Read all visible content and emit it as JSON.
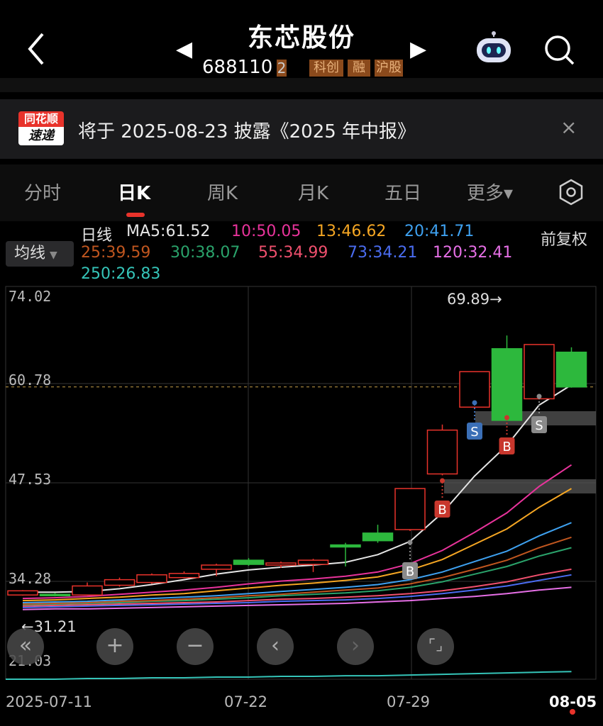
{
  "header": {
    "title": "东芯股份",
    "code": "688110",
    "code_suffix": "2",
    "badges": [
      "科创",
      "融",
      "沪股"
    ]
  },
  "notice": {
    "brand_top": "同花顺",
    "brand_bottom": "速递",
    "text": "将于 2025-08-23 披露《2025 年中报》",
    "close": "×"
  },
  "tabs": [
    "分时",
    "日K",
    "周K",
    "月K",
    "五日",
    "更多▾"
  ],
  "indicator": {
    "label": "日线",
    "ma": [
      {
        "text": "MA5:61.52",
        "color": "#e6e6e6"
      },
      {
        "text": "10:50.05",
        "color": "#e8339b"
      },
      {
        "text": "13:46.62",
        "color": "#f5a623"
      },
      {
        "text": "20:41.71",
        "color": "#3ea1f0"
      },
      {
        "text": "25:39.59",
        "color": "#c0561f"
      },
      {
        "text": "30:38.07",
        "color": "#2aa36b"
      },
      {
        "text": "55:34.99",
        "color": "#f0506e"
      },
      {
        "text": "73:34.21",
        "color": "#4a6cf0"
      },
      {
        "text": "120:32.41",
        "color": "#e66fe6"
      },
      {
        "text": "250:26.83",
        "color": "#35c4b8"
      }
    ],
    "ma_button": "均线",
    "adjust": "前复权"
  },
  "chart_data": {
    "type": "candlestick",
    "y_ticks": [
      "74.02",
      "60.78",
      "47.53",
      "34.28",
      "21.03"
    ],
    "ylim": [
      21.03,
      74.02
    ],
    "x_labels": [
      "2025-07-11",
      "07-22",
      "07-29",
      "08-05"
    ],
    "high_label": "69.89→",
    "low_label": "←31.21",
    "candles": [
      {
        "o": 31.3,
        "c": 31.9,
        "h": 32.0,
        "l": 31.2
      },
      {
        "o": 31.4,
        "c": 31.2,
        "h": 31.6,
        "l": 31.1
      },
      {
        "o": 31.3,
        "c": 32.6,
        "h": 33.1,
        "l": 31.2
      },
      {
        "o": 32.7,
        "c": 33.5,
        "h": 33.8,
        "l": 32.5
      },
      {
        "o": 33.1,
        "c": 34.2,
        "h": 34.4,
        "l": 32.9
      },
      {
        "o": 33.8,
        "c": 34.4,
        "h": 34.7,
        "l": 33.7
      },
      {
        "o": 35.0,
        "c": 35.6,
        "h": 35.8,
        "l": 34.0
      },
      {
        "o": 36.3,
        "c": 35.7,
        "h": 36.6,
        "l": 35.5
      },
      {
        "o": 35.6,
        "c": 35.9,
        "h": 36.1,
        "l": 35.2
      },
      {
        "o": 35.7,
        "c": 36.3,
        "h": 36.5,
        "l": 34.6
      },
      {
        "o": 38.5,
        "c": 38.2,
        "h": 38.8,
        "l": 35.4
      },
      {
        "o": 40.2,
        "c": 39.1,
        "h": 41.4,
        "l": 38.8
      },
      {
        "o": 40.7,
        "c": 46.6,
        "h": 46.6,
        "l": 40.5
      },
      {
        "o": 48.7,
        "c": 55.0,
        "h": 55.8,
        "l": 48.5
      },
      {
        "o": 58.3,
        "c": 63.4,
        "h": 63.4,
        "l": 58.0
      },
      {
        "o": 66.7,
        "c": 56.4,
        "h": 68.6,
        "l": 56.4
      },
      {
        "o": 59.5,
        "c": 67.3,
        "h": 67.3,
        "l": 59.4
      },
      {
        "o": 66.2,
        "c": 61.2,
        "h": 66.9,
        "l": 61.1
      }
    ],
    "signals": [
      {
        "i": 12,
        "label": "B",
        "type": "buy"
      },
      {
        "i": 13,
        "label": "B",
        "type": "buy"
      },
      {
        "i": 14,
        "label": "S",
        "type": "sell"
      },
      {
        "i": 15,
        "label": "B",
        "type": "buy"
      },
      {
        "i": 16,
        "label": "S",
        "type": "grey"
      },
      {
        "i": 12,
        "label": "B",
        "type": "grey"
      }
    ],
    "ma5": [
      31.7,
      31.7,
      31.8,
      32.2,
      32.8,
      33.5,
      34.3,
      34.9,
      35.3,
      35.6,
      36.0,
      37.1,
      39.0,
      43.1,
      48.4,
      52.8,
      58.6,
      61.5
    ],
    "ma10": [
      30.8,
      30.9,
      31.1,
      31.4,
      31.7,
      32.0,
      32.4,
      32.9,
      33.3,
      33.6,
      34.0,
      34.6,
      35.8,
      37.7,
      40.3,
      43.1,
      46.9,
      50.0
    ],
    "ma13": [
      30.5,
      30.6,
      30.8,
      31.0,
      31.3,
      31.5,
      31.9,
      32.3,
      32.7,
      33.0,
      33.4,
      33.9,
      34.9,
      36.4,
      38.6,
      40.8,
      43.9,
      46.6
    ],
    "ma20": [
      30.2,
      30.3,
      30.4,
      30.6,
      30.8,
      31.0,
      31.2,
      31.5,
      31.8,
      32.1,
      32.4,
      32.8,
      33.5,
      34.6,
      36.1,
      37.6,
      39.8,
      41.7
    ],
    "ma25": [
      30.0,
      30.1,
      30.2,
      30.4,
      30.5,
      30.7,
      30.9,
      31.2,
      31.4,
      31.7,
      32.0,
      32.3,
      32.9,
      33.8,
      35.0,
      36.3,
      38.1,
      39.6
    ],
    "ma30": [
      29.9,
      30.0,
      30.1,
      30.2,
      30.4,
      30.5,
      30.7,
      30.9,
      31.2,
      31.4,
      31.6,
      31.9,
      32.4,
      33.2,
      34.3,
      35.4,
      36.9,
      38.1
    ],
    "ma55": [
      29.7,
      29.8,
      29.9,
      30.0,
      30.1,
      30.2,
      30.3,
      30.5,
      30.7,
      30.8,
      31.0,
      31.2,
      31.5,
      31.9,
      32.5,
      33.2,
      34.2,
      35.0
    ],
    "ma73": [
      29.5,
      29.6,
      29.7,
      29.8,
      29.9,
      30.0,
      30.1,
      30.2,
      30.4,
      30.5,
      30.6,
      30.8,
      31.1,
      31.5,
      32.0,
      32.6,
      33.4,
      34.2
    ],
    "ma120": [
      29.2,
      29.3,
      29.3,
      29.4,
      29.5,
      29.6,
      29.7,
      29.8,
      29.9,
      30.0,
      30.1,
      30.3,
      30.5,
      30.8,
      31.1,
      31.5,
      32.0,
      32.4
    ],
    "ma250": [
      19.2,
      19.2,
      19.3,
      19.3,
      19.4,
      19.4,
      19.5,
      19.5,
      19.6,
      19.6,
      19.7,
      19.7,
      19.8,
      19.9,
      20.0,
      20.1,
      20.2,
      20.3
    ],
    "last_price_line": 61.2
  },
  "controls": [
    "«",
    "+",
    "−",
    "‹",
    "›",
    "⌜⌟"
  ],
  "colors": {
    "up": "#e8332b",
    "down": "#2db83d",
    "bg": "#000"
  }
}
